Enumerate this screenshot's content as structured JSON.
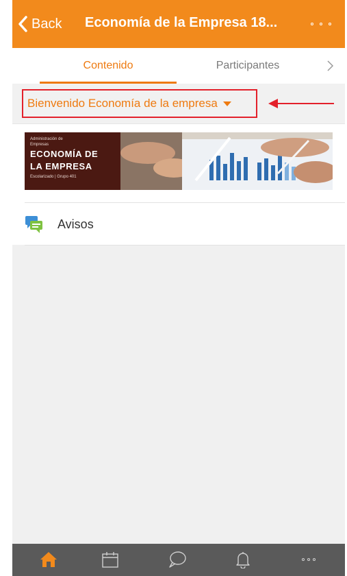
{
  "header": {
    "back_label": "Back",
    "title": "Economía de la Empresa 18..."
  },
  "tabs": [
    {
      "label": "Contenido",
      "active": true
    },
    {
      "label": "Participantes",
      "active": false
    }
  ],
  "section_selector": {
    "label": "Bienvenido Economía de la empresa"
  },
  "banner": {
    "line1": "Administración de",
    "line2": "Empresas",
    "title_line1": "ECONOMÍA DE",
    "title_line2": "LA EMPRESA",
    "footer": "Escolarizado | Grupo 401"
  },
  "modules": [
    {
      "label": "Avisos",
      "icon": "forum-icon"
    }
  ],
  "bottom_nav": [
    {
      "icon": "home-icon",
      "active": true
    },
    {
      "icon": "calendar-icon",
      "active": false
    },
    {
      "icon": "chat-bubble-icon",
      "active": false
    },
    {
      "icon": "bell-icon",
      "active": false
    },
    {
      "icon": "more-icon",
      "active": false
    }
  ],
  "colors": {
    "brand_orange": "#f28a1c",
    "accent_orange": "#ee7a10",
    "highlight_red": "#e3202a",
    "bottom_bar": "#5a5a5a"
  }
}
